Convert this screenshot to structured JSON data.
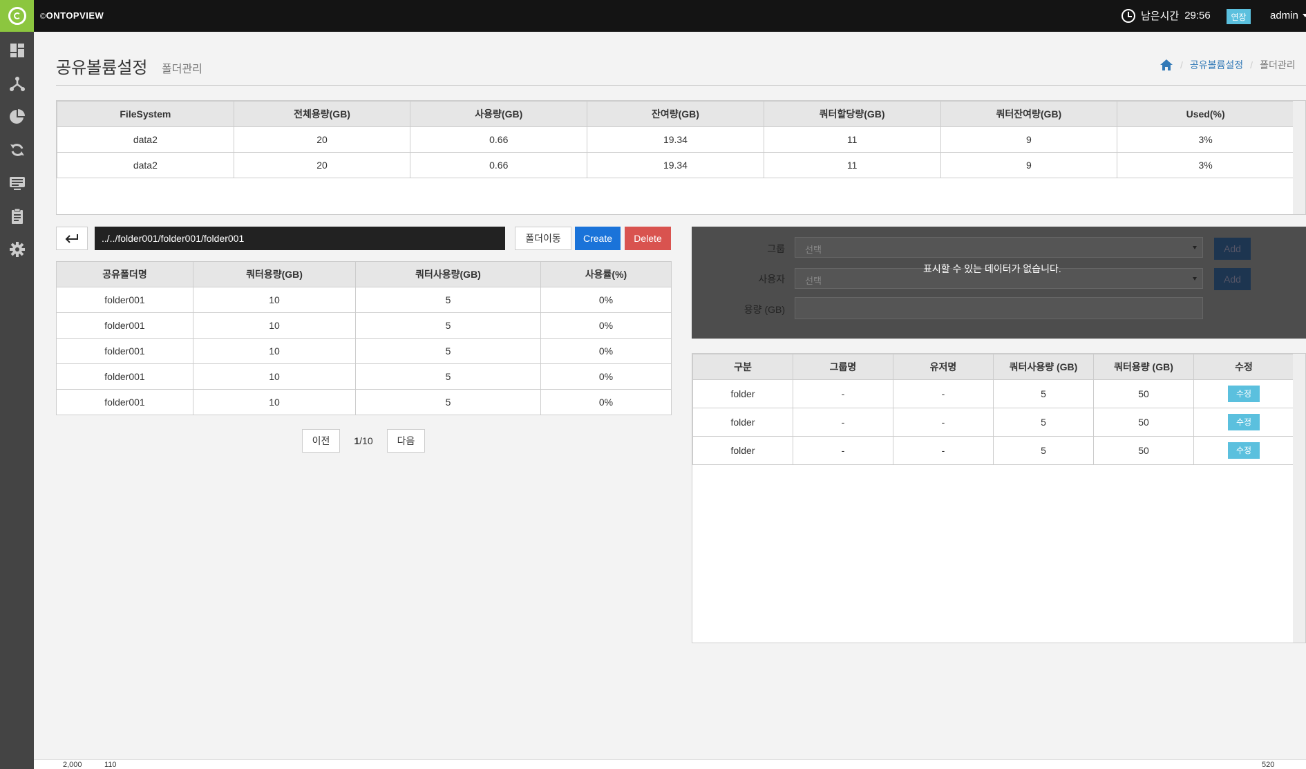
{
  "app": {
    "brand": "ONTOPVIEW",
    "brand_prefix": "©",
    "timer_label": "남은시간",
    "timer_value": "29:56",
    "extend_label": "연장",
    "user": "admin"
  },
  "sidebar": {
    "items": [
      {
        "icon": "dashboard-icon"
      },
      {
        "icon": "network-icon"
      },
      {
        "icon": "pie-chart-icon"
      },
      {
        "icon": "refresh-icon"
      },
      {
        "icon": "monitor-list-icon"
      },
      {
        "icon": "clipboard-icon"
      },
      {
        "icon": "gear-icon"
      }
    ]
  },
  "header": {
    "title": "공유볼륨설정",
    "subtitle": "폴더관리",
    "breadcrumb": {
      "item1": "공유볼륨설정",
      "current": "폴더관리"
    }
  },
  "fs_table": {
    "headers": [
      "FileSystem",
      "전체용량(GB)",
      "사용량(GB)",
      "잔여량(GB)",
      "쿼터할당량(GB)",
      "쿼터잔여량(GB)",
      "Used(%)"
    ],
    "rows": [
      [
        "data2",
        "20",
        "0.66",
        "19.34",
        "11",
        "9",
        "3%"
      ],
      [
        "data2",
        "20",
        "0.66",
        "19.34",
        "11",
        "9",
        "3%"
      ]
    ]
  },
  "path": {
    "value": "../../folder001/folder001/folder001",
    "move_label": "폴더이동",
    "create_label": "Create",
    "delete_label": "Delete"
  },
  "folder_table": {
    "headers": [
      "공유폴더명",
      "쿼터용량(GB)",
      "쿼터사용량(GB)",
      "사용률(%)"
    ],
    "rows": [
      [
        "folder001",
        "10",
        "5",
        "0%"
      ],
      [
        "folder001",
        "10",
        "5",
        "0%"
      ],
      [
        "folder001",
        "10",
        "5",
        "0%"
      ],
      [
        "folder001",
        "10",
        "5",
        "0%"
      ],
      [
        "folder001",
        "10",
        "5",
        "0%"
      ]
    ]
  },
  "pager": {
    "prev": "이전",
    "current": "1",
    "total": "/10",
    "next": "다음"
  },
  "form": {
    "group_label": "그룹",
    "user_label": "사용자",
    "capacity_label": "용량 (GB)",
    "select_placeholder": "선택",
    "add_label": "Add",
    "no_data": "표시할 수 있는 데이터가 없습니다."
  },
  "quota_table": {
    "headers": [
      "구분",
      "그룹명",
      "유저명",
      "쿼터사용량 (GB)",
      "쿼터용량 (GB)",
      "수정"
    ],
    "edit_label": "수정",
    "rows": [
      [
        "folder",
        "-",
        "-",
        "5",
        "50"
      ],
      [
        "folder",
        "-",
        "-",
        "5",
        "50"
      ],
      [
        "folder",
        "-",
        "-",
        "5",
        "50"
      ]
    ]
  },
  "bottom_strip": {
    "left1": "2,000",
    "left2": "110",
    "right": "520"
  }
}
